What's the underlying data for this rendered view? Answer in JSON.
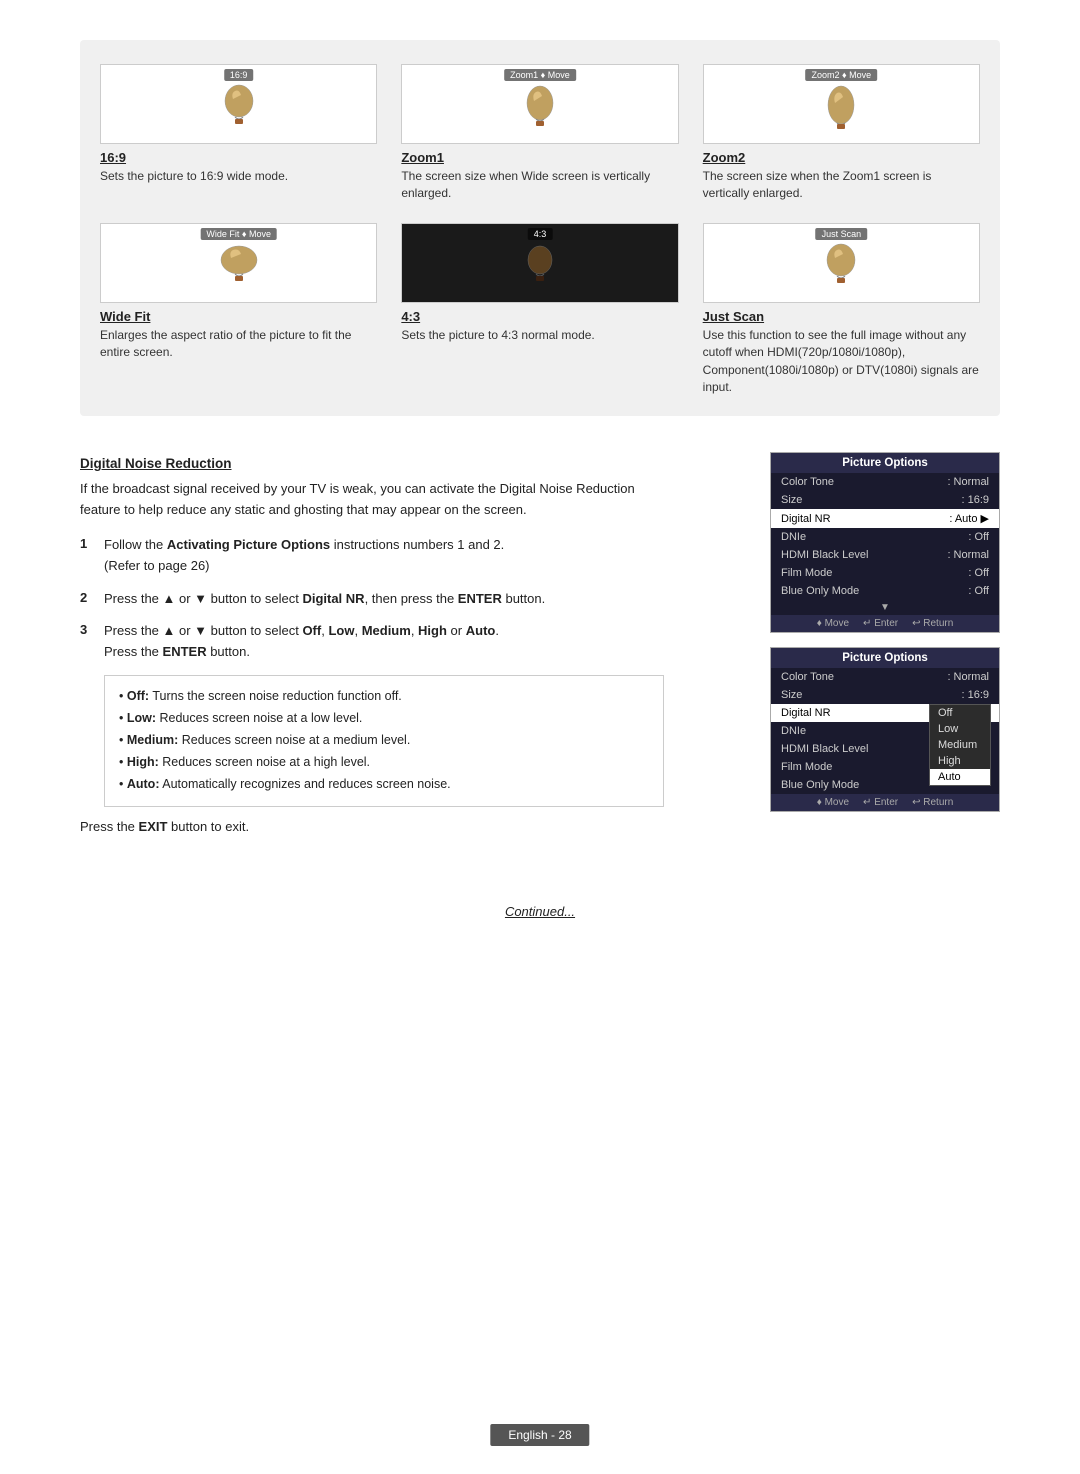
{
  "page": {
    "footer": "English - 28",
    "continued_text": "Continued..."
  },
  "picture_modes": {
    "items": [
      {
        "id": "169",
        "label_bar": "16:9",
        "title": "16:9",
        "desc": "Sets the picture to 16:9 wide mode.",
        "black": false
      },
      {
        "id": "zoom1",
        "label_bar": "Zoom1 ♦ Move",
        "title": "Zoom1",
        "desc": "The screen size when Wide screen is vertically enlarged.",
        "black": false
      },
      {
        "id": "zoom2",
        "label_bar": "Zoom2 ♦ Move",
        "title": "Zoom2",
        "desc": "The screen size when the Zoom1 screen is vertically enlarged.",
        "black": false
      },
      {
        "id": "widefit",
        "label_bar": "Wide Fit ♦ Move",
        "title": "Wide Fit",
        "desc": "Enlarges the aspect ratio of the picture to fit the entire screen.",
        "black": false
      },
      {
        "id": "43",
        "label_bar": "4:3",
        "title": "4:3",
        "desc": "Sets the picture to 4:3 normal mode.",
        "black": true
      },
      {
        "id": "justscan",
        "label_bar": "Just Scan",
        "title": "Just Scan",
        "desc": "Use this function to see the full image without any cutoff when HDMI(720p/1080i/1080p), Component(1080i/1080p) or DTV(1080i) signals are input.",
        "black": false
      }
    ]
  },
  "section": {
    "heading": "Digital Noise Reduction",
    "intro": "If the broadcast signal received by your TV is weak, you can activate the Digital Noise Reduction feature to help reduce any static and ghosting that may appear on the screen.",
    "steps": [
      {
        "num": "1",
        "text": "Follow the ",
        "bold": "Activating Picture Options",
        "text2": " instructions numbers 1 and 2.",
        "sub": "(Refer to page 26)"
      },
      {
        "num": "2",
        "text": "Press the ▲ or ▼ button to select ",
        "bold": "Digital NR",
        "text2": ", then press the ",
        "bold2": "ENTER",
        "text3": " button."
      },
      {
        "num": "3",
        "text": "Press the ▲ or ▼ button to select ",
        "bold": "Off",
        "comma1": ", ",
        "bold2": "Low",
        "comma2": ", ",
        "bold3": "Medium",
        "comma3": ", ",
        "bold4": "High",
        "or": " or ",
        "bold5": "Auto",
        "text2": ".",
        "sub": "Press the ",
        "sub_bold": "ENTER",
        "sub_text2": " button."
      }
    ],
    "bullets": [
      "Off: Turns the screen noise reduction function off.",
      "Low: Reduces screen noise at a low level.",
      "Medium: Reduces screen noise at a medium level.",
      "High: Reduces screen noise at a high level.",
      "Auto: Automatically recognizes and reduces screen noise."
    ],
    "exit_text": "Press the ",
    "exit_bold": "EXIT",
    "exit_text2": " button to exit."
  },
  "panel1": {
    "title": "Picture Options",
    "rows": [
      {
        "label": "Color Tone",
        "value": ": Normal",
        "highlight": false
      },
      {
        "label": "Size",
        "value": ": 16:9",
        "highlight": false
      },
      {
        "label": "Digital NR",
        "value": ": Auto",
        "highlight": true,
        "arrow": true
      },
      {
        "label": "DNIe",
        "value": ": Off",
        "highlight": false
      },
      {
        "label": "HDMI Black Level",
        "value": ": Normal",
        "highlight": false
      },
      {
        "label": "Film Mode",
        "value": ": Off",
        "highlight": false
      },
      {
        "label": "Blue Only Mode",
        "value": ": Off",
        "highlight": false
      }
    ],
    "footer": [
      "♦ Move",
      "↵ Enter",
      "↩ Return"
    ]
  },
  "panel2": {
    "title": "Picture Options",
    "rows": [
      {
        "label": "Color Tone",
        "value": ": Normal",
        "highlight": false
      },
      {
        "label": "Size",
        "value": ": 16:9",
        "highlight": false
      },
      {
        "label": "Digital NR",
        "value": "",
        "highlight": true
      },
      {
        "label": "DNIe",
        "value": "",
        "highlight": false
      },
      {
        "label": "HDMI Black Level",
        "value": "",
        "highlight": false
      },
      {
        "label": "Film Mode",
        "value": "",
        "highlight": false
      },
      {
        "label": "Blue Only Mode",
        "value": "",
        "highlight": false
      }
    ],
    "dropdown_options": [
      "Off",
      "Low",
      "Medium",
      "High",
      "Auto"
    ],
    "dropdown_selected": "Auto",
    "footer": [
      "♦ Move",
      "↵ Enter",
      "↩ Return"
    ]
  }
}
